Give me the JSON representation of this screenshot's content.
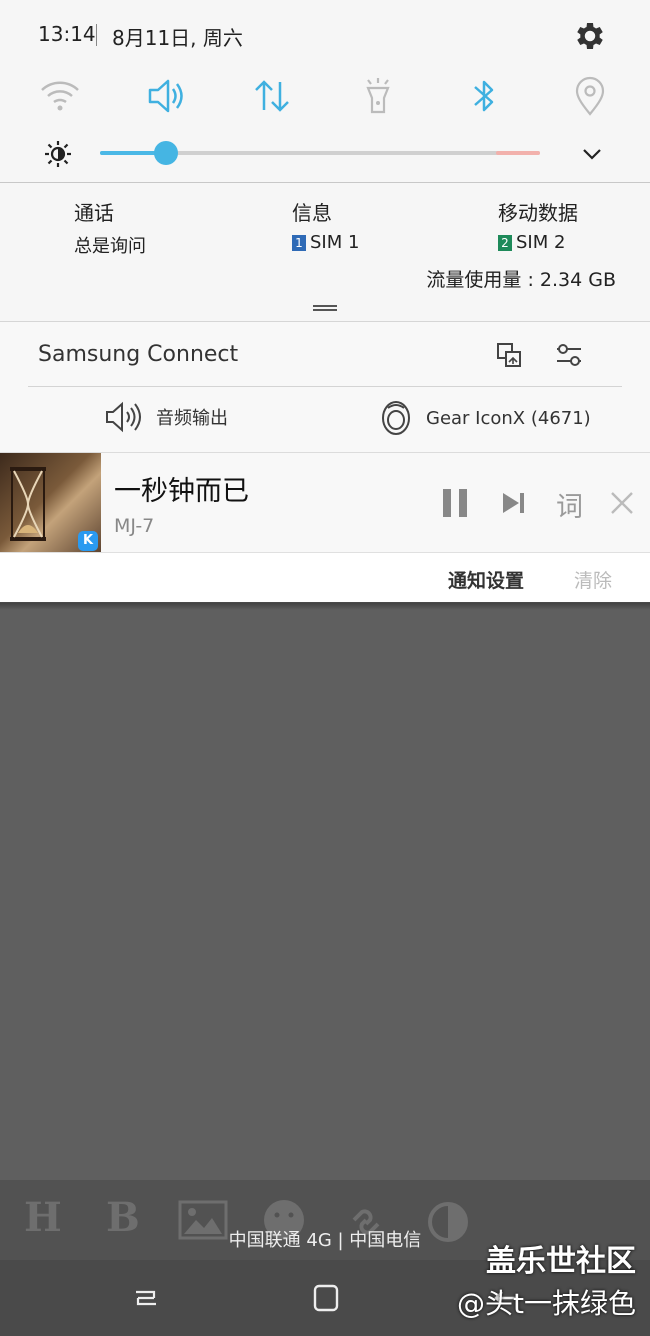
{
  "status": {
    "time": "13:14",
    "date": "8月11日, 周六"
  },
  "quick_settings": {
    "icons": [
      "wifi-icon",
      "sound-icon",
      "mobile-data-icon",
      "flashlight-icon",
      "bluetooth-icon",
      "location-icon"
    ],
    "brightness_level": 0.15,
    "accent_color": "#4bb8e6"
  },
  "sim": {
    "call": {
      "title": "通话",
      "value": "总是询问"
    },
    "message": {
      "title": "信息",
      "sim_num": "1",
      "value": "SIM 1"
    },
    "mobile_data": {
      "title": "移动数据",
      "sim_num": "2",
      "value": "SIM 2"
    },
    "data_usage": "流量使用量 : 2.34 GB"
  },
  "samsung_connect": {
    "title": "Samsung Connect",
    "audio_output": "音频输出",
    "device": "Gear IconX (4671)"
  },
  "media": {
    "title": "一秒钟而已",
    "artist": "MJ-7",
    "lyrics_label": "词",
    "app_badge": "K"
  },
  "notifications": {
    "settings": "通知设置",
    "clear": "清除"
  },
  "editor_toolbar": {
    "icons": [
      "H",
      "B",
      "image-icon",
      "emoji-icon",
      "link-icon",
      "contrast-icon"
    ]
  },
  "carrier_text": "中国联通 4G | 中国电信",
  "watermark": {
    "line1": "盖乐世社区",
    "line2": "@头t一抹绿色"
  }
}
